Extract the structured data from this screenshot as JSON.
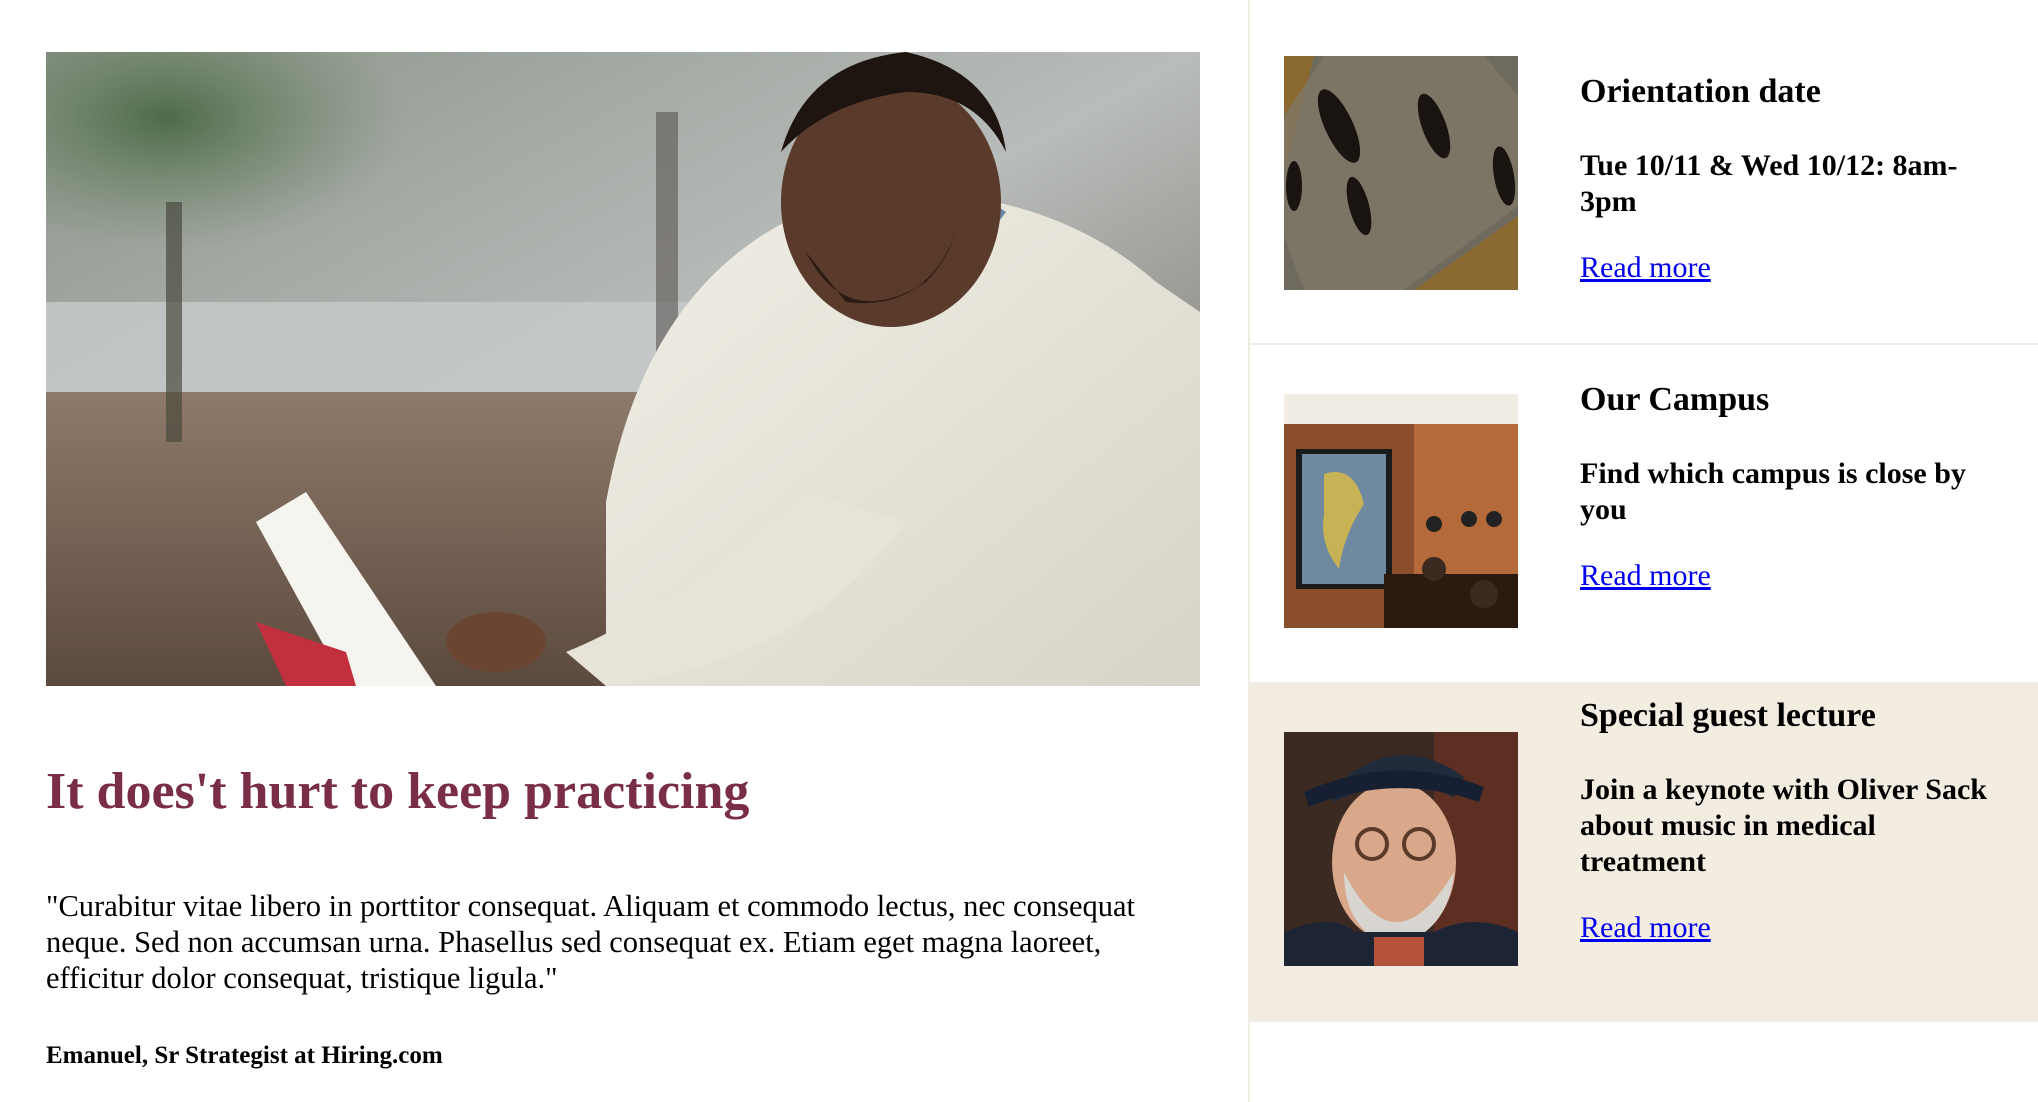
{
  "feature": {
    "headline": "It does't hurt to keep practicing",
    "quote": "\"Curabitur vitae libero in porttitor consequat. Aliquam et commodo lectus, nec consequat neque. Sed non accumsan urna. Phasellus sed consequat ex. Etiam eget magna laoreet, efficitur dolor consequat, tristique ligula.\"",
    "attribution": "Emanuel, Sr Strategist at Hiring.com"
  },
  "sidebar": {
    "cards": [
      {
        "title": "Orientation date",
        "description": "Tue 10/11 & Wed 10/12: 8am-3pm",
        "link": "Read more"
      },
      {
        "title": "Our Campus",
        "description": "Find which campus is close by you",
        "link": "Read more"
      },
      {
        "title": "Special guest lecture",
        "description": "Join a keynote with Oliver Sack about music in medical treatment",
        "link": "Read more"
      }
    ]
  },
  "colors": {
    "headline": "#7a2e46",
    "link": "#0000ee",
    "highlight_card": "#f3ece1",
    "divider": "#f0ece4"
  }
}
